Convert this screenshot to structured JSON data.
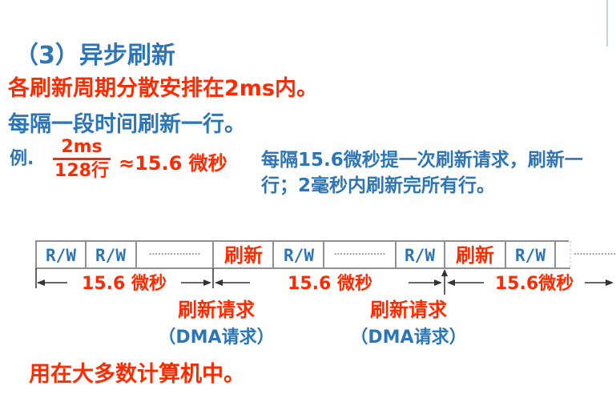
{
  "heading": "（3）异步刷新",
  "line_red": "各刷新周期分散安排在2ms内。",
  "line_blue": "每隔一段时间刷新一行。",
  "example": {
    "label": "例.",
    "numerator": "2ms",
    "denominator": "128行",
    "approx": "≈15.6 微秒",
    "note": "每隔15.6微秒提一次刷新请求，刷新一行；2毫秒内刷新完所有行。"
  },
  "timeline": {
    "cells": [
      "R/W",
      "R/W",
      "刷新",
      "R/W",
      "R/W",
      "刷新",
      "R/W"
    ],
    "dots": ".................",
    "intervals": [
      "15.6 微秒",
      "15.6 微秒",
      "15.6微秒"
    ],
    "requests": [
      {
        "title": "刷新请求",
        "sub": "（DMA请求）"
      },
      {
        "title": "刷新请求",
        "sub": "（DMA请求）"
      }
    ]
  },
  "footer": "用在大多数计算机中。",
  "colors": {
    "blue": "#2e75b6",
    "red": "#ff2a00",
    "gray": "#909090"
  }
}
